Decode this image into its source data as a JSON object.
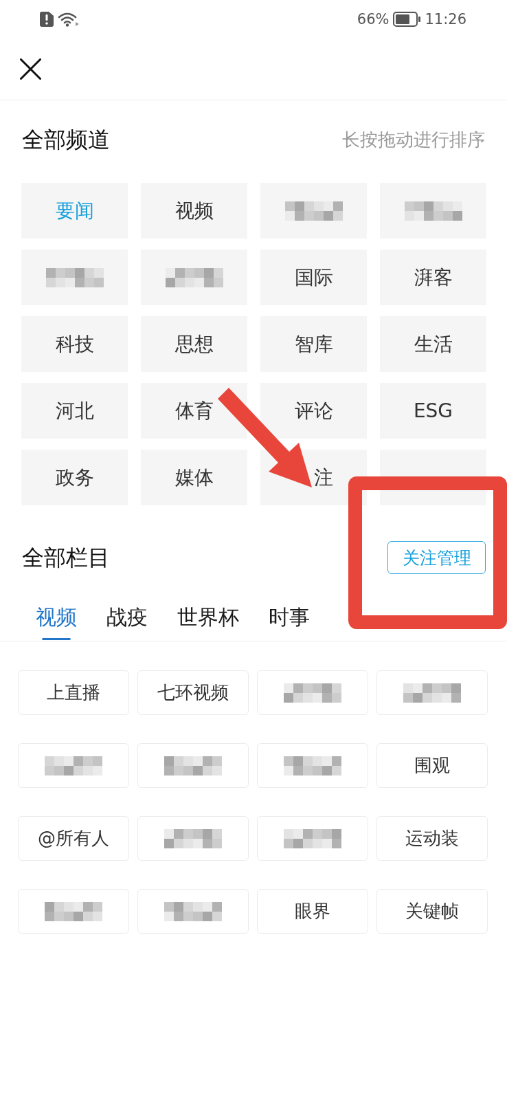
{
  "status_bar": {
    "battery_percent": "66%",
    "time": "11:26"
  },
  "channels": {
    "title": "全部频道",
    "hint": "长按拖动进行排序",
    "items": [
      {
        "kind": "text",
        "label": "要闻",
        "selected": true
      },
      {
        "kind": "text",
        "label": "视频",
        "selected": false
      },
      {
        "kind": "pixelated",
        "selected": false
      },
      {
        "kind": "pixelated",
        "selected": false
      },
      {
        "kind": "pixelated",
        "selected": false
      },
      {
        "kind": "pixelated",
        "selected": false
      },
      {
        "kind": "text",
        "label": "国际",
        "selected": false
      },
      {
        "kind": "text",
        "label": "湃客",
        "selected": false
      },
      {
        "kind": "text",
        "label": "科技",
        "selected": false
      },
      {
        "kind": "text",
        "label": "思想",
        "selected": false
      },
      {
        "kind": "text",
        "label": "智库",
        "selected": false
      },
      {
        "kind": "text",
        "label": "生活",
        "selected": false
      },
      {
        "kind": "text",
        "label": "河北",
        "selected": false
      },
      {
        "kind": "text",
        "label": "体育",
        "selected": false
      },
      {
        "kind": "text",
        "label": "评论",
        "selected": false
      },
      {
        "kind": "text",
        "label": "ESG",
        "selected": false
      },
      {
        "kind": "text",
        "label": "政务",
        "selected": false
      },
      {
        "kind": "text",
        "label": "媒体",
        "selected": false
      },
      {
        "kind": "covered",
        "label": "注",
        "selected": false
      },
      {
        "kind": "blank",
        "selected": false
      }
    ]
  },
  "columns": {
    "title": "全部栏目",
    "manage_button": "关注管理",
    "tabs": [
      {
        "label": "视频",
        "selected": true
      },
      {
        "label": "战疫",
        "selected": false
      },
      {
        "label": "世界杯",
        "selected": false
      },
      {
        "label": "时事",
        "selected": false
      }
    ],
    "items": [
      {
        "kind": "text",
        "label": "上直播"
      },
      {
        "kind": "text",
        "label": "七环视频"
      },
      {
        "kind": "pixelated"
      },
      {
        "kind": "pixelated"
      },
      {
        "kind": "pixelated"
      },
      {
        "kind": "pixelated"
      },
      {
        "kind": "pixelated"
      },
      {
        "kind": "text",
        "label": "围观"
      },
      {
        "kind": "text",
        "label": "@所有人"
      },
      {
        "kind": "pixelated"
      },
      {
        "kind": "pixelated"
      },
      {
        "kind": "text",
        "label": "运动装"
      },
      {
        "kind": "pixelated"
      },
      {
        "kind": "pixelated"
      },
      {
        "kind": "text",
        "label": "眼界"
      },
      {
        "kind": "text",
        "label": "关键帧"
      }
    ]
  },
  "annotations": {
    "arrow": true,
    "highlight_frame": true
  }
}
